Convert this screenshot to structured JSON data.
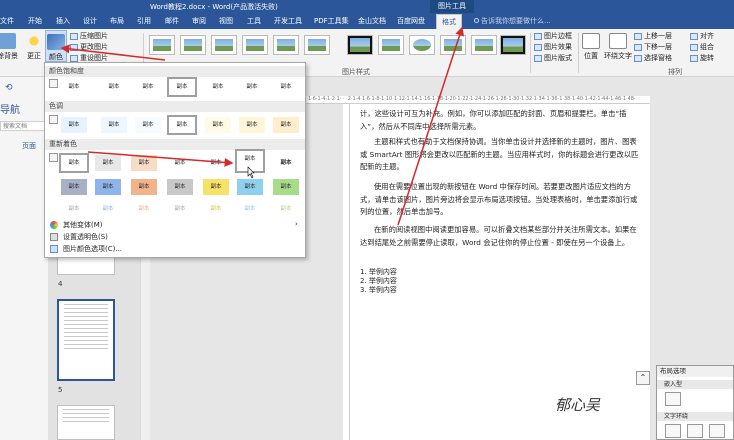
{
  "window": {
    "title": "Word教程2.docx - Word(产品激活失败)",
    "context_tab": "图片工具"
  },
  "tabs": [
    "文件",
    "开始",
    "插入",
    "设计",
    "布局",
    "引用",
    "邮件",
    "审阅",
    "视图",
    "工具",
    "开发工具",
    "PDF工具集",
    "金山文档",
    "百度网盘",
    "格式"
  ],
  "tell_me": "告诉我你想要做什么...",
  "ribbon": {
    "remove_bg": "删除背景",
    "corrections": "更正",
    "color": "颜色",
    "compress": "压缩图片",
    "change": "更改图片",
    "reset": "重设图片",
    "styles_group": "图片样式",
    "border": "图片边框",
    "effects": "图片效果",
    "layout": "图片版式",
    "position": "位置",
    "wrap": "环绕文字",
    "bring_forward": "上移一层",
    "send_backward": "下移一层",
    "selection_pane": "选择窗格",
    "align": "对齐",
    "group": "组合",
    "rotate": "旋转",
    "arrange_group": "排列"
  },
  "nav": {
    "title": "导航",
    "search": "搜索文档",
    "pages_tab": "页面"
  },
  "thumbnails": {
    "page4": "4",
    "page5": "5"
  },
  "dropdown": {
    "sat_section": "颜色饱和度",
    "tone_section": "色调",
    "recolor_section": "重新着色",
    "swatch_label": "副本",
    "more_variants": "其他变体(M)",
    "set_transparent": "设置透明色(S)",
    "color_options": "图片颜色选项(C)..."
  },
  "doc": {
    "para1": "计，这些设计可互为补充。例如，你可以添加匹配的封面、页眉和提要栏。单击“插入”，然后从不同库中选择所需元素。",
    "para2": "主题和样式也有助于文档保持协调。当你单击设计并选择新的主题时，图片、图表或 SmartArt 图形将会更改以匹配新的主题。当应用样式时，你的标题会进行更改以匹配新的主题。",
    "para3": "使用在需要位置出现的新按钮在 Word 中保存时间。若要更改图片适应文档的方式，请单击该图片，图片旁边将会显示布局选项按钮。当处理表格时，单击要添加行或列的位置，然后单击加号。",
    "para4": "在新的阅读视图中阅读更加容易。可以折叠文档某些部分并关注所需文本。如果在达到结尾处之前需要停止读取，Word 会记住你的停止位置 - 即使在另一个设备上。",
    "list": [
      "1. 举例内容",
      "2. 举例内容",
      "3. 举例内容"
    ],
    "signature": "郁心吴"
  },
  "layout_panel": {
    "title": "布局选项",
    "inline": "嵌入型",
    "wrap": "文字环绕"
  }
}
